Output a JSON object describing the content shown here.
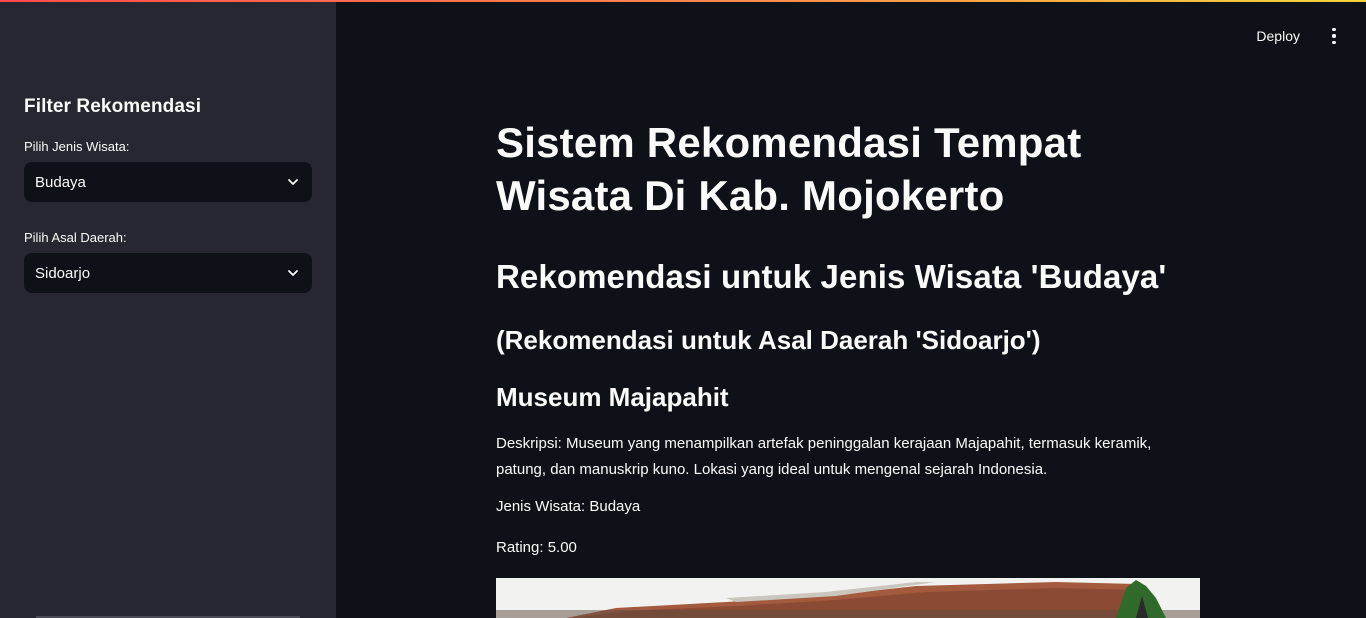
{
  "sidebar": {
    "title": "Filter Rekomendasi",
    "jenis_label": "Pilih Jenis Wisata:",
    "jenis_value": "Budaya",
    "asal_label": "Pilih Asal Daerah:",
    "asal_value": "Sidoarjo"
  },
  "header": {
    "deploy_label": "Deploy",
    "menu_icon": "vertical-dots-icon"
  },
  "main": {
    "title": "Sistem Rekomendasi Tempat Wisata Di Kab. Mojokerto",
    "subheader": "Rekomendasi untuk Jenis Wisata 'Budaya'",
    "subsubheader": "(Rekomendasi untuk Asal Daerah 'Sidoarjo')",
    "place_name": "Museum Majapahit",
    "description": "Deskripsi: Museum yang menampilkan artefak peninggalan kerajaan Majapahit, termasuk keramik, patung, dan manuskrip kuno. Lokasi yang ideal untuk mengenal sejarah Indonesia.",
    "jenis_wisata": "Jenis Wisata: Budaya",
    "rating": "Rating: 5.00"
  },
  "colors": {
    "background": "#0e1117",
    "sidebar": "#262730",
    "text": "#fafafa",
    "accent_gradient_start": "#ff4b4b",
    "accent_gradient_end": "#ffd43a"
  }
}
